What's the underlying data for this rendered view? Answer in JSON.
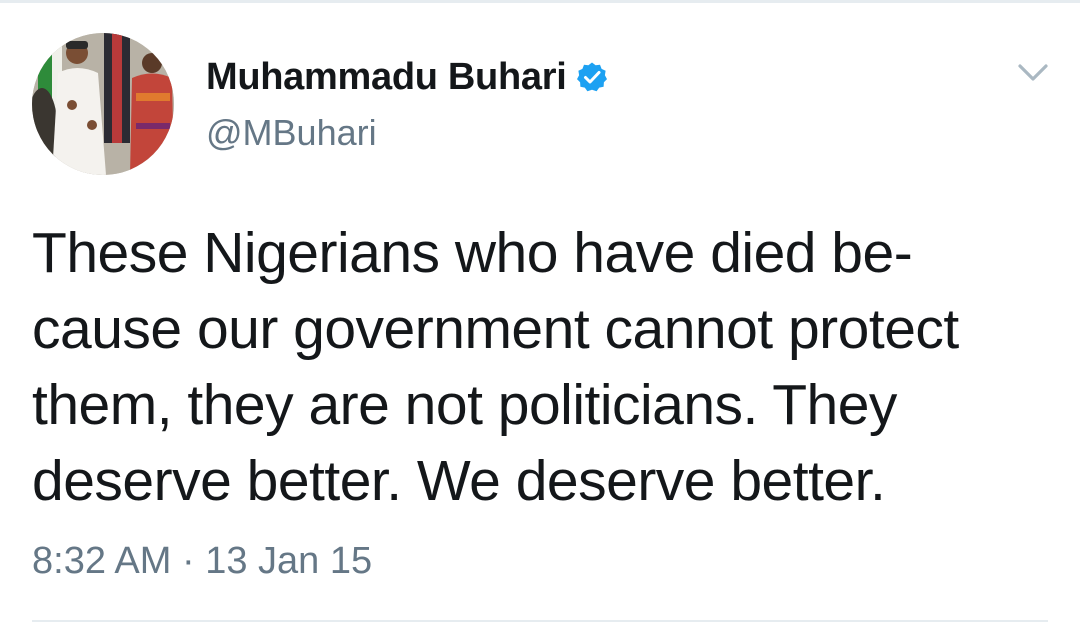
{
  "tweet": {
    "author": {
      "display_name": "Muhammadu Buhari",
      "handle": "@MBuhari",
      "verified": true,
      "verified_icon": "verified-badge-icon"
    },
    "text_lines": [
      "These Nigerians who have died be-",
      "cause our government cannot protect",
      "them, they are not politicians. They",
      "deserve better. We deserve better."
    ],
    "timestamp": "8:32 AM · 13 Jan 15",
    "menu_icon": "chevron-down-icon"
  },
  "colors": {
    "verified_blue": "#1da1f2",
    "text_primary": "#14171a",
    "text_secondary": "#657786",
    "divider": "#e6ecf0"
  }
}
